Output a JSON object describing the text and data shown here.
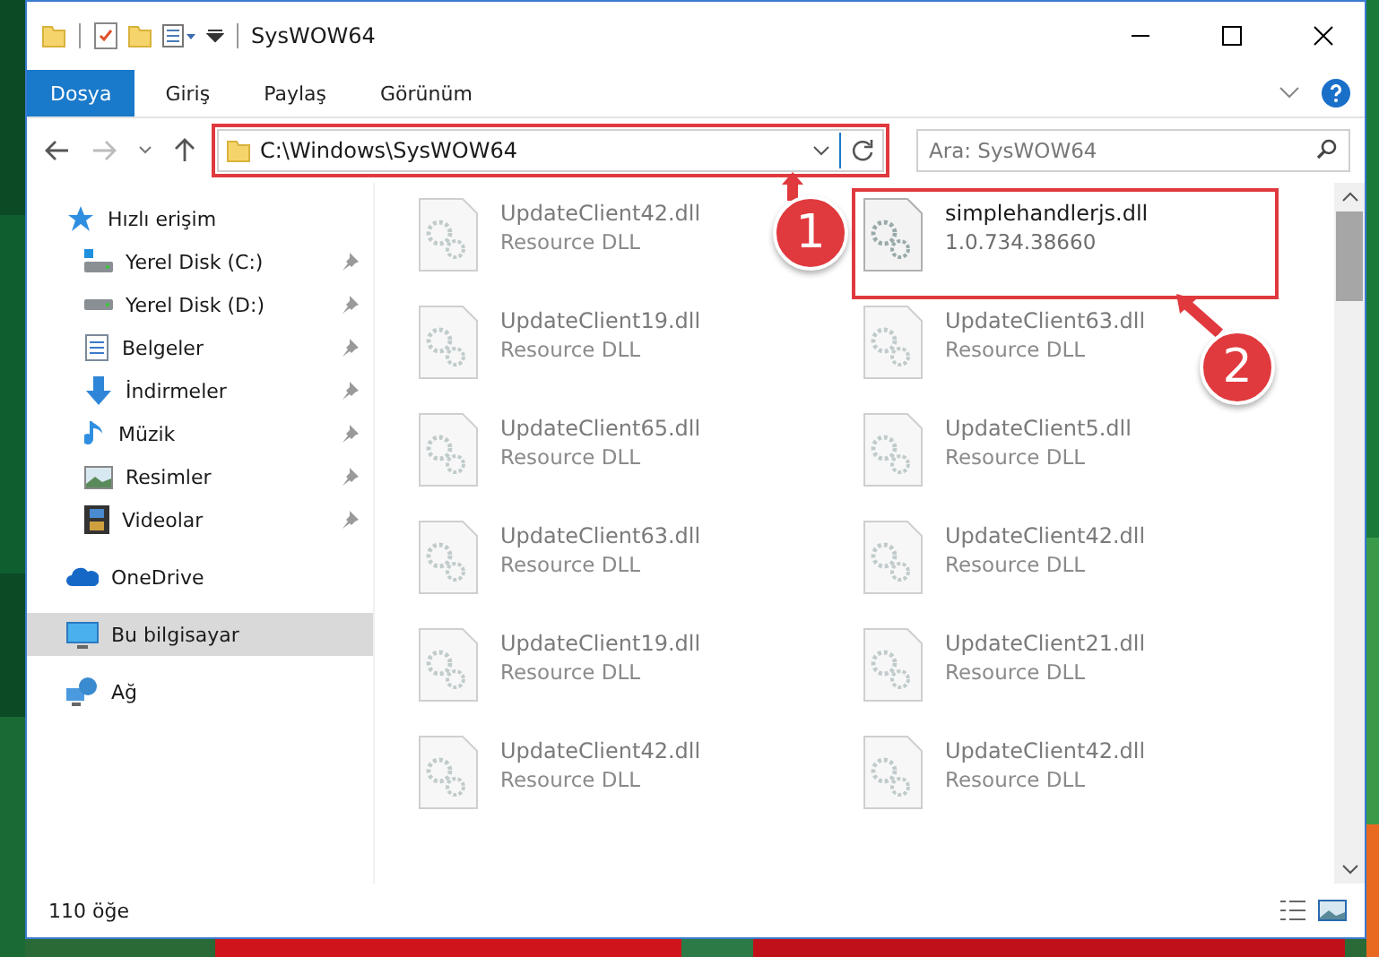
{
  "window": {
    "title": "SysWOW64"
  },
  "ribbon_tabs": [
    {
      "label": "Dosya",
      "selected": true
    },
    {
      "label": "Giriş",
      "selected": false
    },
    {
      "label": "Paylaş",
      "selected": false
    },
    {
      "label": "Görünüm",
      "selected": false
    }
  ],
  "address": {
    "path": "C:\\Windows\\SysWOW64",
    "highlighted": true
  },
  "search": {
    "placeholder": "Ara: SysWOW64"
  },
  "sidebar": {
    "items": [
      {
        "label": "Hızlı erişim",
        "selected": false,
        "children": [
          {
            "label": "Yerel Disk (C:)",
            "pinned": true,
            "selected": false
          },
          {
            "label": "Yerel Disk (D:)",
            "pinned": true,
            "selected": false
          },
          {
            "label": "Belgeler",
            "pinned": true,
            "selected": false
          },
          {
            "label": "İndirmeler",
            "pinned": true,
            "selected": false
          },
          {
            "label": "Müzik",
            "pinned": true,
            "selected": false
          },
          {
            "label": "Resimler",
            "pinned": true,
            "selected": false
          },
          {
            "label": "Videolar",
            "pinned": true,
            "selected": false
          }
        ]
      },
      {
        "label": "OneDrive",
        "selected": false
      },
      {
        "label": "Bu bilgisayar",
        "selected": true
      },
      {
        "label": "Ağ",
        "selected": false
      }
    ]
  },
  "files": [
    {
      "name": "UpdateClient42.dll",
      "detail": "Resource DLL",
      "blurred": true,
      "highlighted": false
    },
    {
      "name": "simplehandlerjs.dll",
      "detail": "1.0.734.38660",
      "blurred": false,
      "highlighted": true
    },
    {
      "name": "UpdateClient19.dll",
      "detail": "Resource DLL",
      "blurred": true,
      "highlighted": false
    },
    {
      "name": "UpdateClient63.dll",
      "detail": "Resource DLL",
      "blurred": true,
      "highlighted": false
    },
    {
      "name": "UpdateClient65.dll",
      "detail": "Resource DLL",
      "blurred": true,
      "highlighted": false
    },
    {
      "name": "UpdateClient5.dll",
      "detail": "Resource DLL",
      "blurred": true,
      "highlighted": false
    },
    {
      "name": "UpdateClient63.dll",
      "detail": "Resource DLL",
      "blurred": true,
      "highlighted": false
    },
    {
      "name": "UpdateClient42.dll",
      "detail": "Resource DLL",
      "blurred": true,
      "highlighted": false
    },
    {
      "name": "UpdateClient19.dll",
      "detail": "Resource DLL",
      "blurred": true,
      "highlighted": false
    },
    {
      "name": "UpdateClient21.dll",
      "detail": "Resource DLL",
      "blurred": true,
      "highlighted": false
    },
    {
      "name": "UpdateClient42.dll",
      "detail": "Resource DLL",
      "blurred": true,
      "highlighted": false
    },
    {
      "name": "UpdateClient42.dll",
      "detail": "Resource DLL",
      "blurred": true,
      "highlighted": false
    }
  ],
  "callouts": [
    {
      "number": "1"
    },
    {
      "number": "2"
    }
  ],
  "status_bar": {
    "count": "110 öğe"
  }
}
